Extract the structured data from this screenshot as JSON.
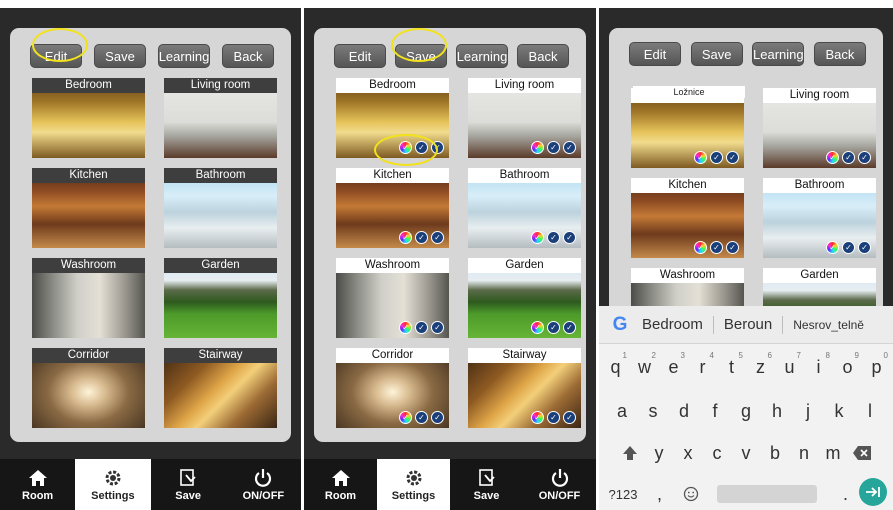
{
  "toolbar": {
    "edit": "Edit",
    "save": "Save",
    "learning": "Learning",
    "back": "Back"
  },
  "rooms": [
    {
      "name": "Bedroom"
    },
    {
      "name": "Living room"
    },
    {
      "name": "Kitchen"
    },
    {
      "name": "Bathroom"
    },
    {
      "name": "Washroom"
    },
    {
      "name": "Garden"
    },
    {
      "name": "Corridor"
    },
    {
      "name": "Stairway"
    }
  ],
  "nav": {
    "room": "Room",
    "settings": "Settings",
    "save": "Save",
    "onoff": "ON/OFF"
  },
  "tooltip": "Ložnice",
  "keyboard": {
    "suggestions": [
      "Bedroom",
      "Beroun",
      "Nesrov_telně"
    ],
    "row1": [
      "q",
      "w",
      "e",
      "r",
      "t",
      "z",
      "u",
      "i",
      "o",
      "p"
    ],
    "row1_sup": [
      "1",
      "2",
      "3",
      "4",
      "5",
      "6",
      "7",
      "8",
      "9",
      "0"
    ],
    "row2": [
      "a",
      "s",
      "d",
      "f",
      "g",
      "h",
      "j",
      "k",
      "l"
    ],
    "row3": [
      "y",
      "x",
      "c",
      "v",
      "b",
      "n",
      "m"
    ],
    "symbols": "?123",
    "comma": ",",
    "period": "."
  },
  "colors": {
    "highlight": "#f2e21b",
    "accent": "#26a69a"
  }
}
